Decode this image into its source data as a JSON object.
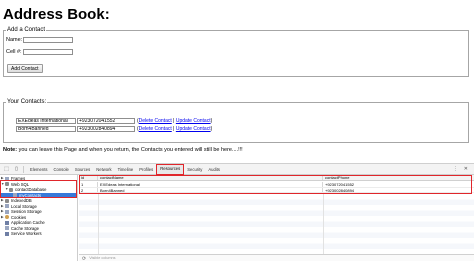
{
  "page": {
    "title": "Address Book:",
    "add_legend": "Add a Contact",
    "name_label": "Name:",
    "cell_label": "Cell #:",
    "add_button": "Add Contact",
    "contacts_legend": "Your Contacts:",
    "contacts": [
      {
        "name": "EXEdeas International",
        "phone": "+923072041552",
        "delete": "Delete Contact",
        "sep": "|",
        "update": "Update Contact"
      },
      {
        "name": "Born4Banned",
        "phone": "+923002840894",
        "delete": "Delete Contact",
        "sep": "|",
        "update": "Update Contact"
      }
    ],
    "note_bold": "Note:",
    "note_text": " you can leave this Page and when you return, the Contacts you entered will still be here....!!!"
  },
  "devtools": {
    "tabs": [
      "Elements",
      "Console",
      "Sources",
      "Network",
      "Timeline",
      "Profiles",
      "Resources",
      "Security",
      "Audits"
    ],
    "active_tab": "Resources",
    "tree": {
      "frames": "Frames",
      "web_sql": "Web SQL",
      "database": "contactDatabase",
      "table": "myContacts",
      "indexeddb": "IndexedDB",
      "local_storage": "Local Storage",
      "session_storage": "Session Storage",
      "cookies": "Cookies",
      "app_cache": "Application Cache",
      "cache_storage": "Cache Storage",
      "service_workers": "Service Workers"
    },
    "grid": {
      "columns": [
        "id",
        "contactName",
        "contactPhone"
      ],
      "rows": [
        [
          "1",
          "EXEdeas International",
          "+923072041552"
        ],
        [
          "2",
          "Born4Banned",
          "+923002840894"
        ]
      ]
    },
    "filter_placeholder": "Visible columns"
  },
  "colors": {
    "highlight": "#e0262b",
    "selection": "#3879d9",
    "link": "#0000ee"
  }
}
